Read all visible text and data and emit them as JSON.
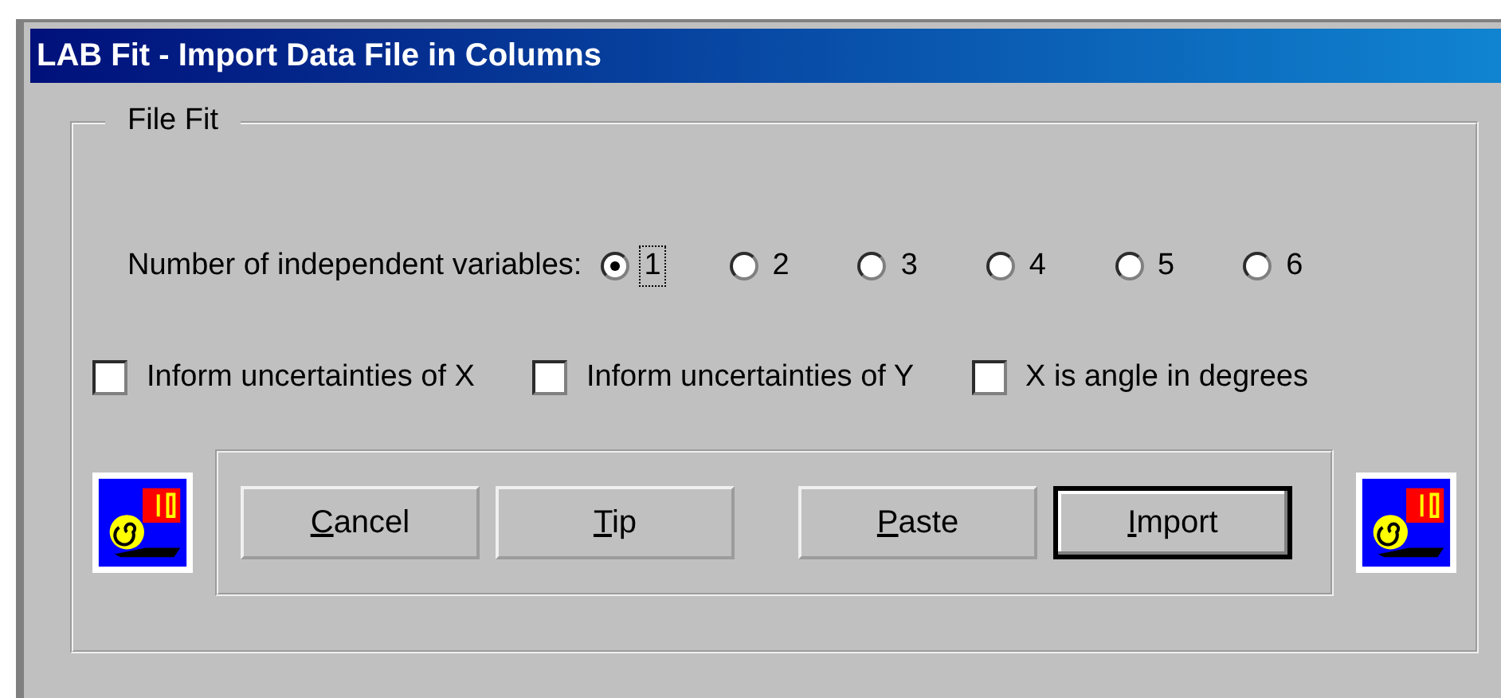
{
  "window": {
    "title": "LAB Fit - Import Data File in Columns"
  },
  "group": {
    "label": "File Fit"
  },
  "variables": {
    "label": "Number of independent variables:",
    "options": [
      {
        "label": "1",
        "selected": true,
        "focused": true
      },
      {
        "label": "2",
        "selected": false,
        "focused": false
      },
      {
        "label": "3",
        "selected": false,
        "focused": false
      },
      {
        "label": "4",
        "selected": false,
        "focused": false
      },
      {
        "label": "5",
        "selected": false,
        "focused": false
      },
      {
        "label": "6",
        "selected": false,
        "focused": false
      }
    ]
  },
  "checkboxes": [
    {
      "label": "Inform uncertainties of X",
      "checked": false
    },
    {
      "label": "Inform uncertainties of Y",
      "checked": false
    },
    {
      "label": "X is angle in degrees",
      "checked": false
    }
  ],
  "buttons": [
    {
      "key": "C",
      "rest": "ancel",
      "default": false
    },
    {
      "key": "T",
      "rest": "ip",
      "default": false
    },
    {
      "key": "P",
      "rest": "aste",
      "default": false
    },
    {
      "key": "I",
      "rest": "mport",
      "default": true
    }
  ]
}
